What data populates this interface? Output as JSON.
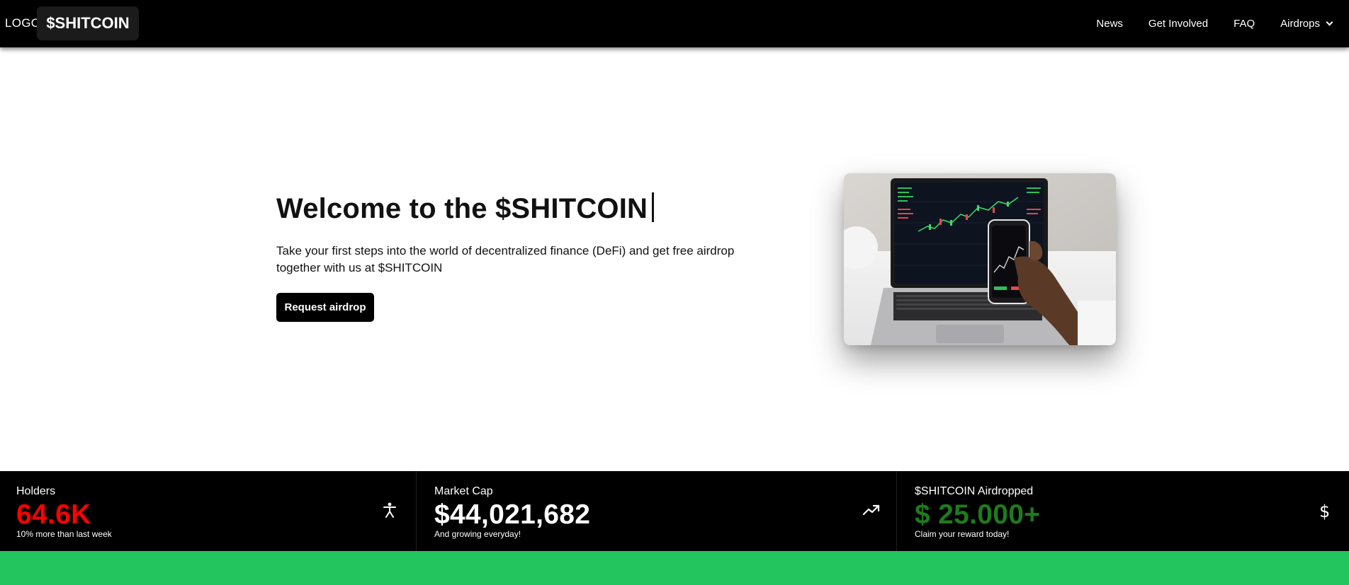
{
  "nav": {
    "logo_text": "LOGO",
    "brand": "$SHITCOIN",
    "links": [
      {
        "label": "News"
      },
      {
        "label": "Get Involved"
      },
      {
        "label": "FAQ"
      },
      {
        "label": "Airdrops",
        "icon": "chevron-down-icon"
      }
    ]
  },
  "hero": {
    "title": "Welcome to the $SHITCOIN",
    "subtitle": "Take your first steps into the world of decentralized finance (DeFi) and get free airdrop together with us at $SHITCOIN",
    "cta_label": "Request airdrop",
    "image_icon": "laptop-phone-trading-photo"
  },
  "stats": [
    {
      "label": "Holders",
      "value": "64.6K",
      "value_color": "#ff0000",
      "footnote": "10% more than last week",
      "icon": "person-icon"
    },
    {
      "label": "Market Cap",
      "value": "$44,021,682",
      "value_color": "#ffffff",
      "footnote": "And growing everyday!",
      "icon": "trending-up-icon"
    },
    {
      "label": "$SHITCOIN Airdropped",
      "value": "$ 25.000+",
      "value_color": "#1f7a1f",
      "footnote": "Claim your reward today!",
      "icon": "dollar-icon"
    }
  ],
  "colors": {
    "nav_bg": "#000000",
    "accent_green": "#22c55e",
    "holders_red": "#ff0000",
    "airdrop_green": "#1f7a1f"
  }
}
